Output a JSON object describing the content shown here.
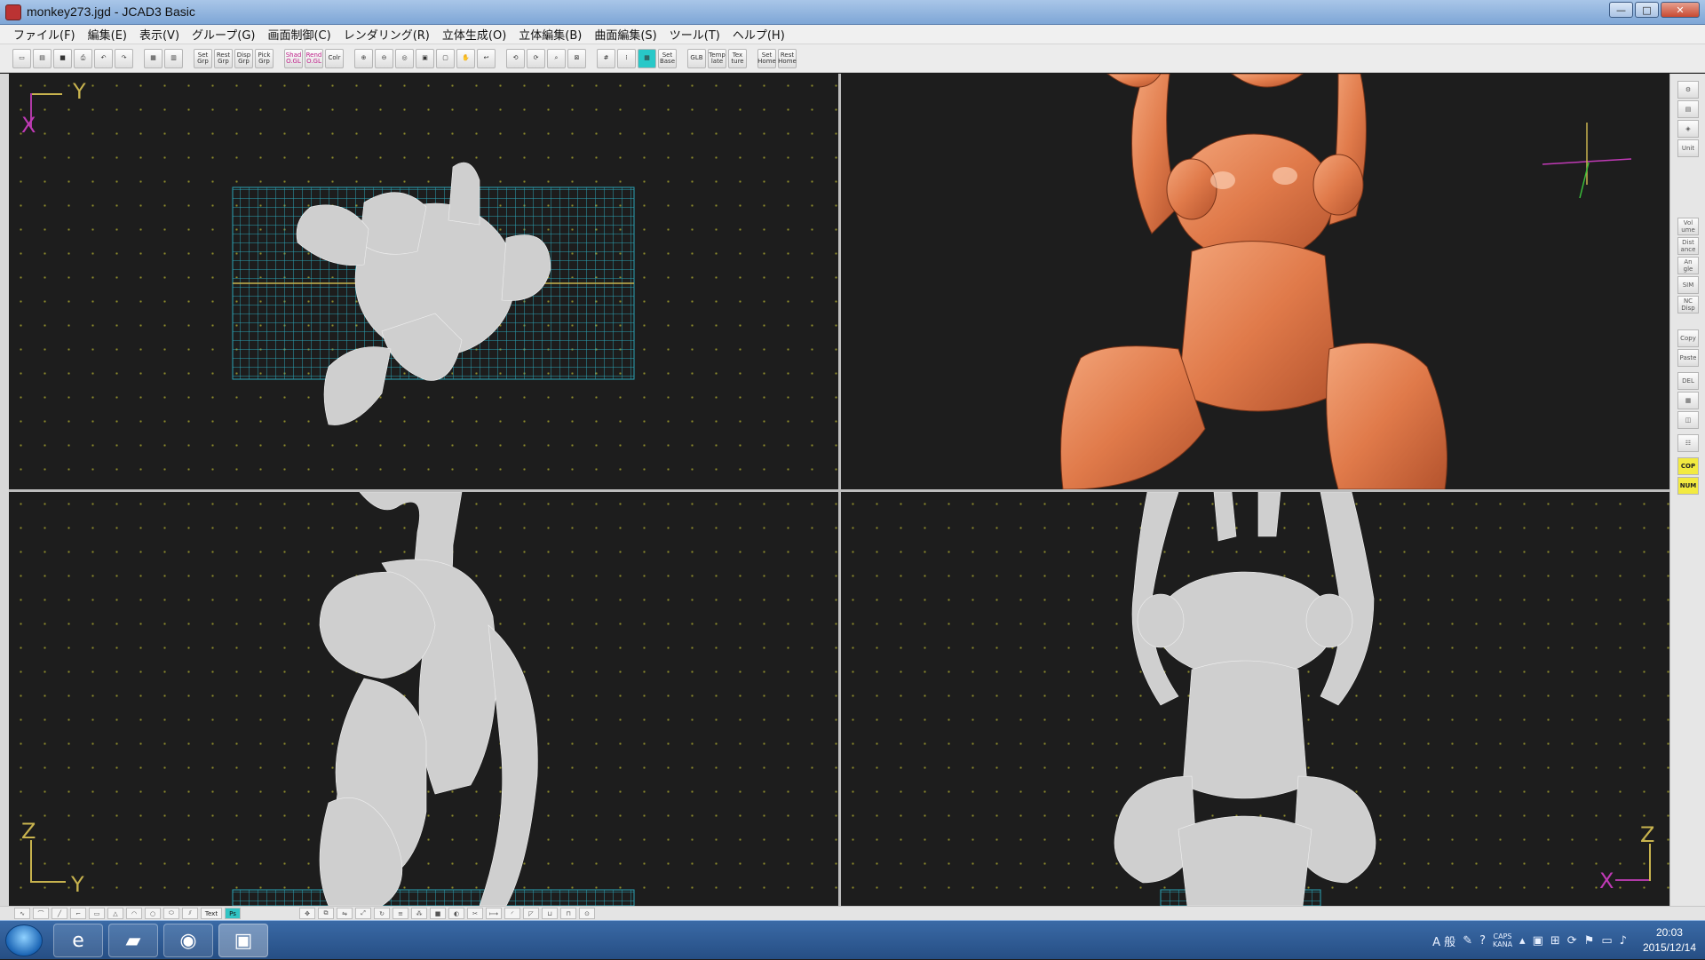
{
  "window": {
    "title": "monkey273.jgd - JCAD3 Basic",
    "buttons": {
      "minimize": "—",
      "maximize": "□",
      "close": "✕"
    }
  },
  "menu": [
    "ファイル(F)",
    "編集(E)",
    "表示(V)",
    "グループ(G)",
    "画面制御(C)",
    "レンダリング(R)",
    "立体生成(O)",
    "立体編集(B)",
    "曲面編集(S)",
    "ツール(T)",
    "ヘルプ(H)"
  ],
  "toolbar": {
    "set_grp": "Set\nGrp",
    "reset_grp": "Rest\nGrp",
    "disp_grp": "Disp\nGrp",
    "pick_grp": "Pick\nGrp",
    "shad_ogl": "Shad\nO.GL",
    "rend_ogl": "Rend\nO.GL",
    "color": "Colr",
    "set_base": "Set\nBase",
    "glb": "GLB",
    "template": "Temp\nlate",
    "texture": "Tex\nture",
    "set_home": "Set\nHome",
    "rest_home": "Rest\nHome"
  },
  "viewports": {
    "top": {
      "axis_v": "X",
      "axis_h": "Y"
    },
    "side": {
      "axis_v": "Z",
      "axis_h": "Y"
    },
    "front": {
      "axis_v": "Z",
      "axis_h": "X"
    }
  },
  "sidebar": {
    "unit": "Unit",
    "volume": "Vol\nume",
    "distance": "Dist\nance",
    "angle": "An\ngle",
    "sim": "SIM",
    "nc_disp": "NC\nDisp",
    "copy": "Copy",
    "paste": "Paste",
    "del": "DEL",
    "cop": "COP",
    "num": "NUM"
  },
  "bottom": {
    "text_label": "Text",
    "ps_label": "Ps"
  },
  "taskbar": {
    "tray_text": "A 般",
    "caps": "CAPS",
    "kana": "KANA",
    "time": "20:03",
    "date": "2015/12/14"
  },
  "colors": {
    "viewport_bg": "#1d1d1d",
    "grid_cyan": "#2aa3b5",
    "axis_yellow": "#c8b34e",
    "axis_magenta": "#c03ab6",
    "copper": "#e88a5a"
  }
}
